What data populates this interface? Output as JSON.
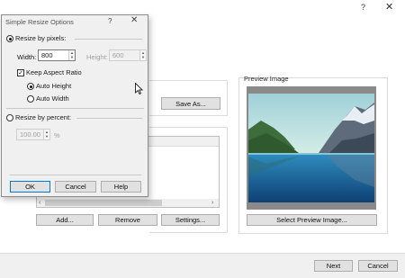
{
  "wizard": {
    "help_glyph": "?",
    "close_glyph": "✕",
    "save_as_label": "Save As...",
    "add_label": "Add...",
    "remove_label": "Remove",
    "settings_label": "Settings...",
    "preview_label": "Preview Image",
    "select_preview_label": "Select Preview Image...",
    "next_label": "Next",
    "cancel_label": "Cancel"
  },
  "dialog": {
    "title": "Simple Resize Options",
    "help_glyph": "?",
    "close_glyph": "✕",
    "resize_by_pixels_label": "Resize by pixels:",
    "width_label": "Width:",
    "width_value": "800",
    "height_label": "Height:",
    "height_value": "600",
    "keep_aspect_label": "Keep Aspect Ratio",
    "auto_height_label": "Auto Height",
    "auto_width_label": "Auto Width",
    "resize_by_percent_label": "Resize by percent:",
    "percent_value": "100.00",
    "percent_unit": "%",
    "ok_label": "OK",
    "cancel_label": "Cancel",
    "help_label": "Help"
  },
  "state": {
    "resize_by_pixels_selected": true,
    "keep_aspect_checked": true,
    "auto_height_selected": true
  }
}
